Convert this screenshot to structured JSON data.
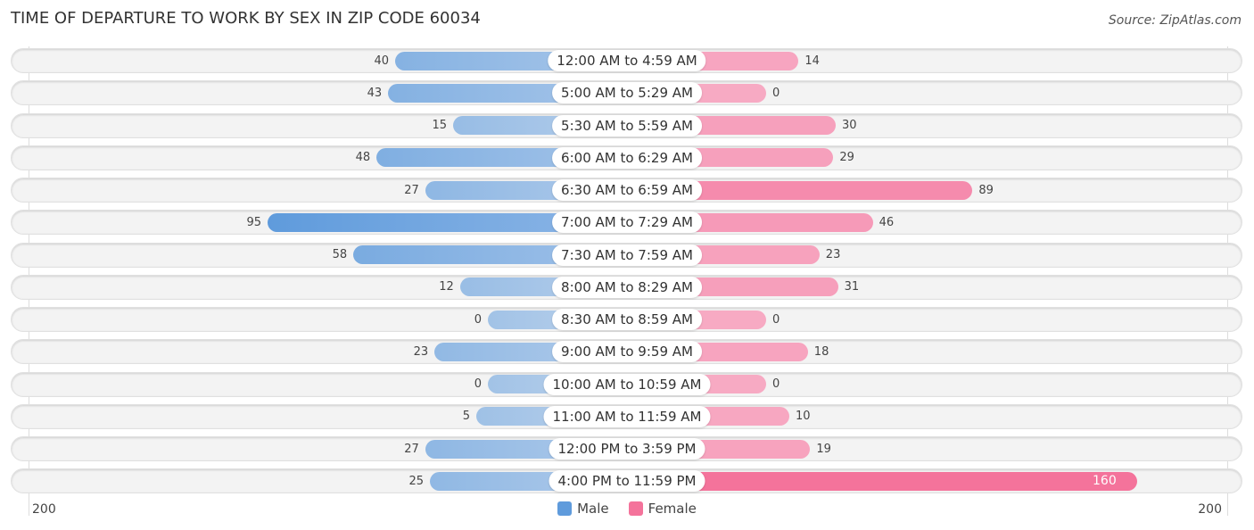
{
  "chart_data": {
    "type": "bar",
    "orientation": "horizontal-diverging",
    "title": "TIME OF DEPARTURE TO WORK BY SEX IN ZIP CODE 60034",
    "source": "Source: ZipAtlas.com",
    "categories": [
      "12:00 AM to 4:59 AM",
      "5:00 AM to 5:29 AM",
      "5:30 AM to 5:59 AM",
      "6:00 AM to 6:29 AM",
      "6:30 AM to 6:59 AM",
      "7:00 AM to 7:29 AM",
      "7:30 AM to 7:59 AM",
      "8:00 AM to 8:29 AM",
      "8:30 AM to 8:59 AM",
      "9:00 AM to 9:59 AM",
      "10:00 AM to 10:59 AM",
      "11:00 AM to 11:59 AM",
      "12:00 PM to 3:59 PM",
      "4:00 PM to 11:59 PM"
    ],
    "series": [
      {
        "name": "Male",
        "color": "#5f9bdc",
        "values": [
          40,
          43,
          15,
          48,
          27,
          95,
          58,
          12,
          0,
          23,
          0,
          5,
          27,
          25
        ]
      },
      {
        "name": "Female",
        "color": "#f4739b",
        "values": [
          14,
          0,
          30,
          29,
          89,
          46,
          23,
          31,
          0,
          18,
          0,
          10,
          19,
          160
        ]
      }
    ],
    "axis": {
      "left_tick": "200",
      "right_tick": "200",
      "max": 200
    },
    "legend": {
      "position": "bottom-center",
      "items": [
        "Male",
        "Female"
      ]
    }
  }
}
